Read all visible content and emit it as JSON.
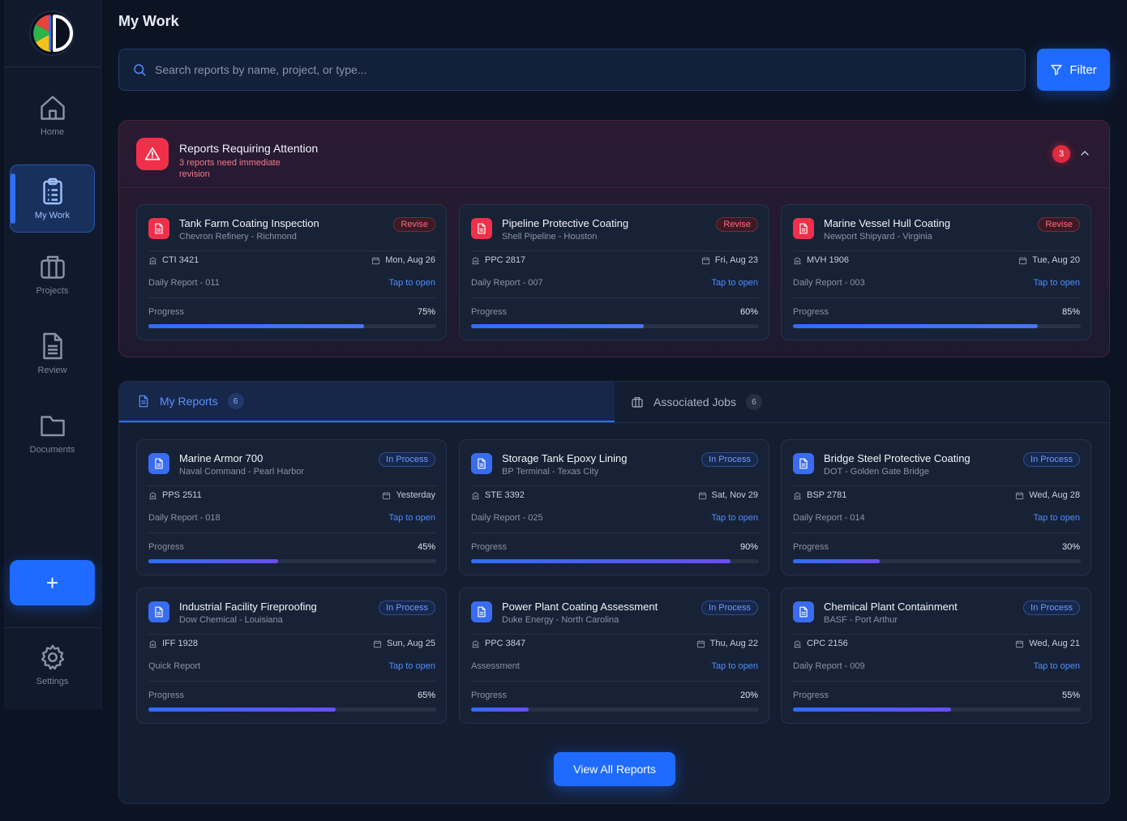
{
  "nav": {
    "home": "Home",
    "mywork": "My Work",
    "projects": "Projects",
    "review": "Review",
    "documents": "Documents",
    "settings": "Settings",
    "add": "+"
  },
  "page": {
    "title": "My Work"
  },
  "search": {
    "placeholder": "Search reports by name, project, or type..."
  },
  "filter": {
    "label": "Filter"
  },
  "attention": {
    "title": "Reports Requiring Attention",
    "subtitle": "3 reports need immediate revision",
    "count": "3",
    "cards": [
      {
        "title": "Tank Farm Coating Inspection",
        "subtitle": "Chevron Refinery - Richmond",
        "status": "Revise",
        "code": "CTI 3421",
        "date": "Mon, Aug 26",
        "report": "Daily Report - 011",
        "action": "Tap to open",
        "progress_label": "Progress",
        "progress_text": "75%",
        "progress": 75
      },
      {
        "title": "Pipeline Protective Coating",
        "subtitle": "Shell Pipeline - Houston",
        "status": "Revise",
        "code": "PPC 2817",
        "date": "Fri, Aug 23",
        "report": "Daily Report - 007",
        "action": "Tap to open",
        "progress_label": "Progress",
        "progress_text": "60%",
        "progress": 60
      },
      {
        "title": "Marine Vessel Hull Coating",
        "subtitle": "Newport Shipyard - Virginia",
        "status": "Revise",
        "code": "MVH 1906",
        "date": "Tue, Aug 20",
        "report": "Daily Report - 003",
        "action": "Tap to open",
        "progress_label": "Progress",
        "progress_text": "85%",
        "progress": 85
      }
    ]
  },
  "tabs": {
    "reports": {
      "label": "My Reports",
      "count": "6"
    },
    "jobs": {
      "label": "Associated Jobs",
      "count": "6"
    }
  },
  "reports": [
    {
      "title": "Marine Armor 700",
      "subtitle": "Naval Command - Pearl Harbor",
      "status": "In Process",
      "code": "PPS 2511",
      "date": "Yesterday",
      "report": "Daily Report - 018",
      "action": "Tap to open",
      "progress_label": "Progress",
      "progress_text": "45%",
      "progress": 45
    },
    {
      "title": "Storage Tank Epoxy Lining",
      "subtitle": "BP Terminal - Texas City",
      "status": "In Process",
      "code": "STE 3392",
      "date": "Sat, Nov 29",
      "report": "Daily Report - 025",
      "action": "Tap to open",
      "progress_label": "Progress",
      "progress_text": "90%",
      "progress": 90
    },
    {
      "title": "Bridge Steel Protective Coating",
      "subtitle": "DOT - Golden Gate Bridge",
      "status": "In Process",
      "code": "BSP 2781",
      "date": "Wed, Aug 28",
      "report": "Daily Report - 014",
      "action": "Tap to open",
      "progress_label": "Progress",
      "progress_text": "30%",
      "progress": 30
    },
    {
      "title": "Industrial Facility Fireproofing",
      "subtitle": "Dow Chemical - Louisiana",
      "status": "In Process",
      "code": "IFF 1928",
      "date": "Sun, Aug 25",
      "report": "Quick Report",
      "action": "Tap to open",
      "progress_label": "Progress",
      "progress_text": "65%",
      "progress": 65
    },
    {
      "title": "Power Plant Coating Assessment",
      "subtitle": "Duke Energy - North Carolina",
      "status": "In Process",
      "code": "PPC 3847",
      "date": "Thu, Aug 22",
      "report": "Assessment",
      "action": "Tap to open",
      "progress_label": "Progress",
      "progress_text": "20%",
      "progress": 20
    },
    {
      "title": "Chemical Plant Containment",
      "subtitle": "BASF - Port Arthur",
      "status": "In Process",
      "code": "CPC 2156",
      "date": "Wed, Aug 21",
      "report": "Daily Report - 009",
      "action": "Tap to open",
      "progress_label": "Progress",
      "progress_text": "55%",
      "progress": 55
    }
  ],
  "view_all": {
    "label": "View All Reports"
  },
  "colors": {
    "accent": "#1f6bff",
    "danger": "#f0304a",
    "background": "#0c1424"
  }
}
